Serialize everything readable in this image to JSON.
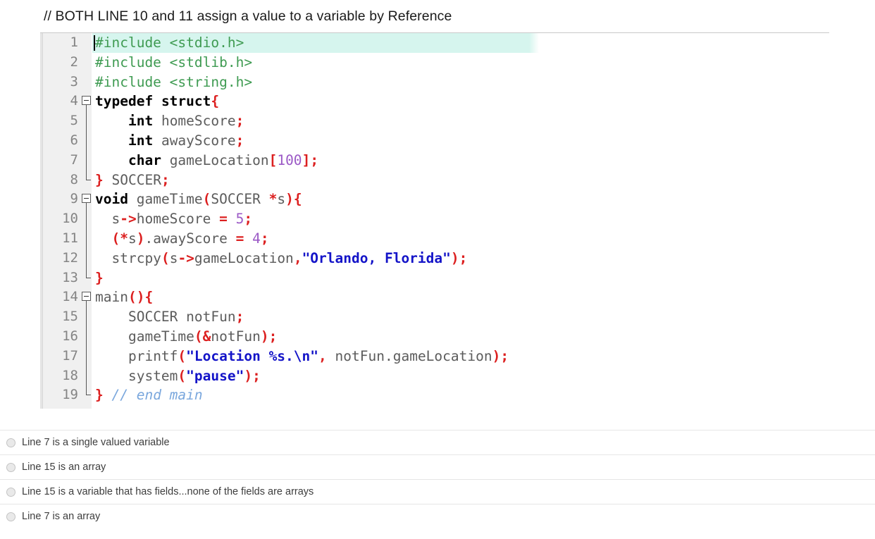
{
  "question": {
    "prompt": "// BOTH LINE 10 and 11 assign a value to a variable by Reference"
  },
  "editor": {
    "language": "C",
    "current_line": 1,
    "highlight_color": "#d6f5ee",
    "gutter_color": "#f0f0f0",
    "colors": {
      "preprocessor": "#3f9b52",
      "keyword": "#000000",
      "identifier": "#5c5c5c",
      "operator": "#dc2020",
      "number": "#9b59c6",
      "string": "#1414c8",
      "comment": "#7aa7dd"
    },
    "lines": [
      {
        "n": "1",
        "fold": "none",
        "plain": "#include <stdio.h>"
      },
      {
        "n": "2",
        "fold": "none",
        "plain": "#include <stdlib.h>"
      },
      {
        "n": "3",
        "fold": "none",
        "plain": "#include <string.h>"
      },
      {
        "n": "4",
        "fold": "open",
        "plain": "typedef struct{"
      },
      {
        "n": "5",
        "fold": "thru",
        "plain": "    int homeScore;"
      },
      {
        "n": "6",
        "fold": "thru",
        "plain": "    int awayScore;"
      },
      {
        "n": "7",
        "fold": "thru",
        "plain": "    char gameLocation[100];"
      },
      {
        "n": "8",
        "fold": "end",
        "plain": "} SOCCER;"
      },
      {
        "n": "9",
        "fold": "open",
        "plain": "void gameTime(SOCCER *s){"
      },
      {
        "n": "10",
        "fold": "thru",
        "plain": "  s->homeScore = 5;"
      },
      {
        "n": "11",
        "fold": "thru",
        "plain": "  (*s).awayScore = 4;"
      },
      {
        "n": "12",
        "fold": "thru",
        "plain": "  strcpy(s->gameLocation,\"Orlando, Florida\");"
      },
      {
        "n": "13",
        "fold": "end",
        "plain": "}"
      },
      {
        "n": "14",
        "fold": "open",
        "plain": "main(){"
      },
      {
        "n": "15",
        "fold": "thru",
        "plain": "    SOCCER notFun;"
      },
      {
        "n": "16",
        "fold": "thru",
        "plain": "    gameTime(&notFun);"
      },
      {
        "n": "17",
        "fold": "thru",
        "plain": "    printf(\"Location %s.\\n\", notFun.gameLocation);"
      },
      {
        "n": "18",
        "fold": "thru",
        "plain": "    system(\"pause\");"
      },
      {
        "n": "19",
        "fold": "end",
        "plain": "} // end main"
      }
    ]
  },
  "answers": {
    "options": [
      {
        "label": "Line 7 is a single valued variable",
        "selected": false
      },
      {
        "label": "Line 15 is an array",
        "selected": false
      },
      {
        "label": "Line 15 is a variable that has fields...none of the fields are arrays",
        "selected": false
      },
      {
        "label": "Line 7 is an array",
        "selected": false
      }
    ]
  }
}
